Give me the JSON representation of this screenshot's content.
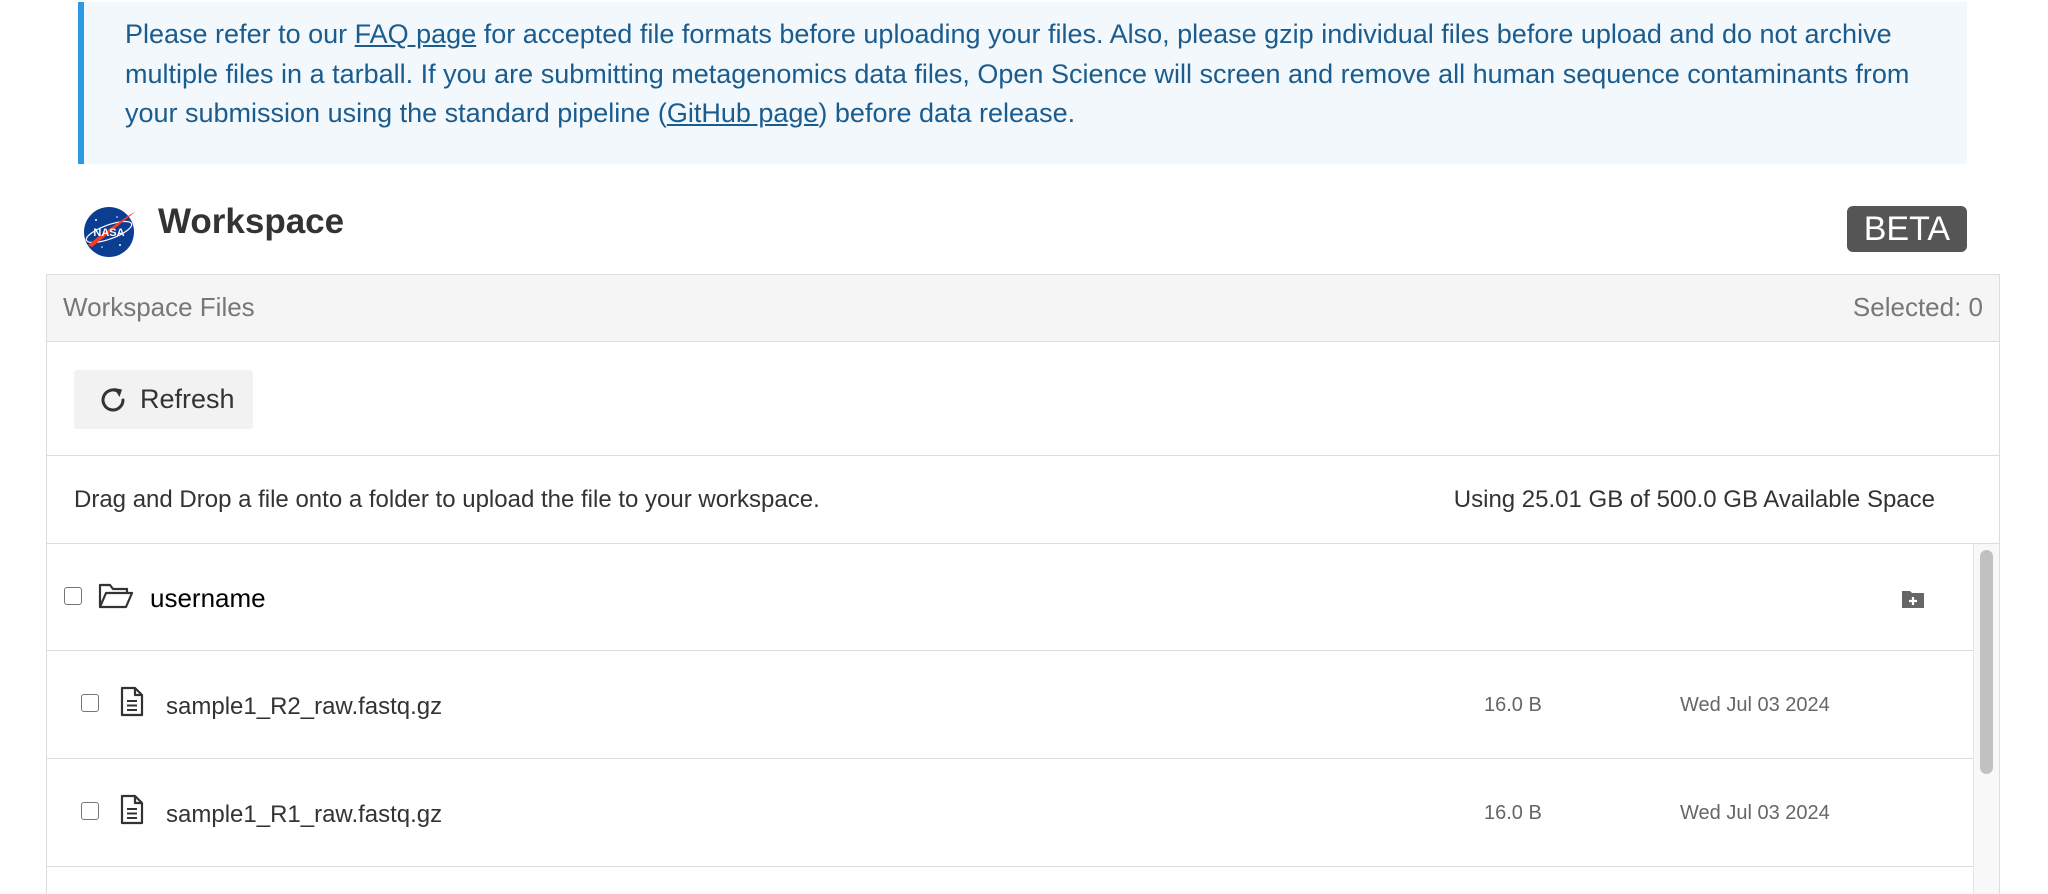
{
  "notice": {
    "line1_before": "Please refer to our ",
    "faq_link": "FAQ page",
    "line1_after": " for accepted file formats before uploading your files. Also, please gzip individual files before upload and do not archive",
    "line2": "multiple files in a tarball. If you are submitting metagenomics data files, Open Science will screen and remove all human sequence contaminants from",
    "line3_before": "your submission using the standard pipeline (",
    "github_link": "GitHub page",
    "line3_after": ") before data release."
  },
  "header": {
    "logo_text": "NASA",
    "title": "Workspace",
    "badge": "BETA"
  },
  "panel": {
    "title": "Workspace Files",
    "selected": "Selected: 0",
    "refresh_label": "Refresh",
    "drag_text": "Drag and Drop a file onto a folder to upload the file to your workspace.",
    "usage_text": "Using 25.01 GB of 500.0 GB Available Space"
  },
  "folder": {
    "name": "username"
  },
  "files": [
    {
      "name": "sample1_R2_raw.fastq.gz",
      "size": "16.0 B",
      "date": "Wed Jul 03 2024"
    },
    {
      "name": "sample1_R1_raw.fastq.gz",
      "size": "16.0 B",
      "date": "Wed Jul 03 2024"
    }
  ],
  "colors": {
    "notice_border": "#2b9ae2",
    "notice_bg": "#f3f8fc",
    "notice_text": "#1b5c8e",
    "badge_bg": "#555555"
  }
}
